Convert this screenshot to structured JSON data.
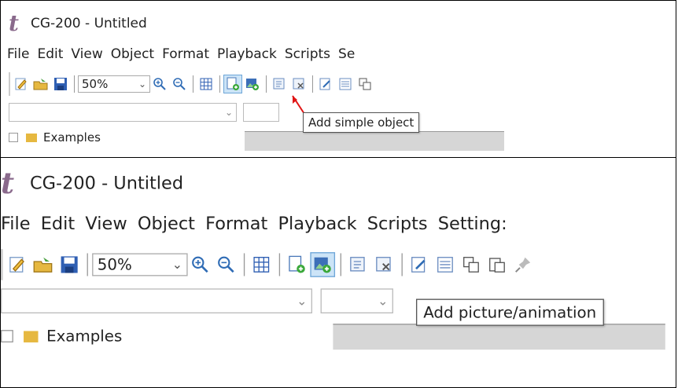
{
  "window": {
    "app_logo": "t",
    "title": "CG-200 - Untitled"
  },
  "menu_top": [
    "File",
    "Edit",
    "View",
    "Object",
    "Format",
    "Playback",
    "Scripts",
    "Se"
  ],
  "menu_bottom": [
    "File",
    "Edit",
    "View",
    "Object",
    "Format",
    "Playback",
    "Scripts",
    "Setting:"
  ],
  "toolbar": {
    "zoom_value": "50%"
  },
  "tree": {
    "folder_label": "Examples"
  },
  "tooltips": {
    "top": "Add simple object",
    "bottom": "Add picture/animation"
  },
  "colors": {
    "accent_active": "#cce4f7",
    "pointer_arrow": "#e01515",
    "logo": "#8a6a8c"
  },
  "icons": [
    "edit-icon",
    "open-folder-icon",
    "save-icon",
    "zoom-in-icon",
    "zoom-out-icon",
    "grid-icon",
    "add-simple-object-icon",
    "add-picture-animation-icon",
    "add-clip-icon",
    "delete-icon",
    "properties-icon",
    "list-icon",
    "copy-icon",
    "paste-icon",
    "pin-icon"
  ]
}
